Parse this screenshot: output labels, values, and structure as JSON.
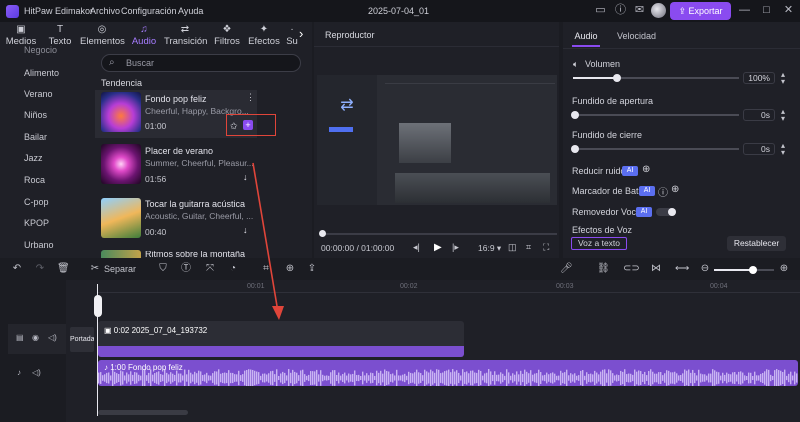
{
  "titlebar": {
    "app_name": "HitPaw Edimakor",
    "menu": [
      "Archivo",
      "Configuración",
      "Ayuda"
    ],
    "project": "2025-07-04_01",
    "export_label": "Exportar"
  },
  "topnav": {
    "items": [
      "Medios",
      "Texto",
      "Elementos",
      "Audio",
      "Transición",
      "Filtros",
      "Efectos",
      "Su"
    ],
    "active": "Audio"
  },
  "categories": [
    "Negocio",
    "Alimento",
    "Verano",
    "Niños",
    "Bailar",
    "Jazz",
    "Roca",
    "C-pop",
    "KPOP",
    "Urbano"
  ],
  "tracklist": {
    "search_placeholder": "Buscar",
    "section": "Tendencia",
    "tracks": [
      {
        "title": "Fondo pop feliz",
        "tags": "Cheerful, Happy, Backgro...",
        "duration": "01:00"
      },
      {
        "title": "Placer de verano",
        "tags": "Summer, Cheerful, Pleasur...",
        "duration": "01:56"
      },
      {
        "title": "Tocar la guitarra acústica",
        "tags": "Acoustic, Guitar, Cheerful, ...",
        "duration": "00:40"
      },
      {
        "title": "Ritmos sobre la montaña",
        "tags": "",
        "duration": ""
      }
    ]
  },
  "player": {
    "title": "Reproductor",
    "time": "00:00:00 / 01:00:00",
    "ratio": "16:9"
  },
  "props": {
    "tabs": [
      "Audio",
      "Velocidad"
    ],
    "volume_label": "Volumen",
    "volume_value": "100%",
    "fade_in_label": "Fundido de apertura",
    "fade_in_value": "0s",
    "fade_out_label": "Fundido de cierre",
    "fade_out_value": "0s",
    "noise_label": "Reducir ruido",
    "beat_label": "Marcador de Batir",
    "vocal_label": "Removedor Vocal",
    "voice_effects_label": "Efectos de Voz",
    "voice_to_text": "Voz a texto",
    "reset": "Restablecer",
    "ai": "AI"
  },
  "toolbar": {
    "split_label": "Separar"
  },
  "timeline": {
    "ruler": [
      "00:01",
      "00:02",
      "00:03",
      "00:04"
    ],
    "cover_label": "Portada",
    "video_clip": "0:02  2025_07_04_193732",
    "audio_clip": "1:00  Fondo pop feliz"
  },
  "colors": {
    "accent": "#8a4bf0",
    "ai_badge": "#5b6ff0",
    "audio_track": "#7b4fcf",
    "annotation": "#e0453a"
  }
}
